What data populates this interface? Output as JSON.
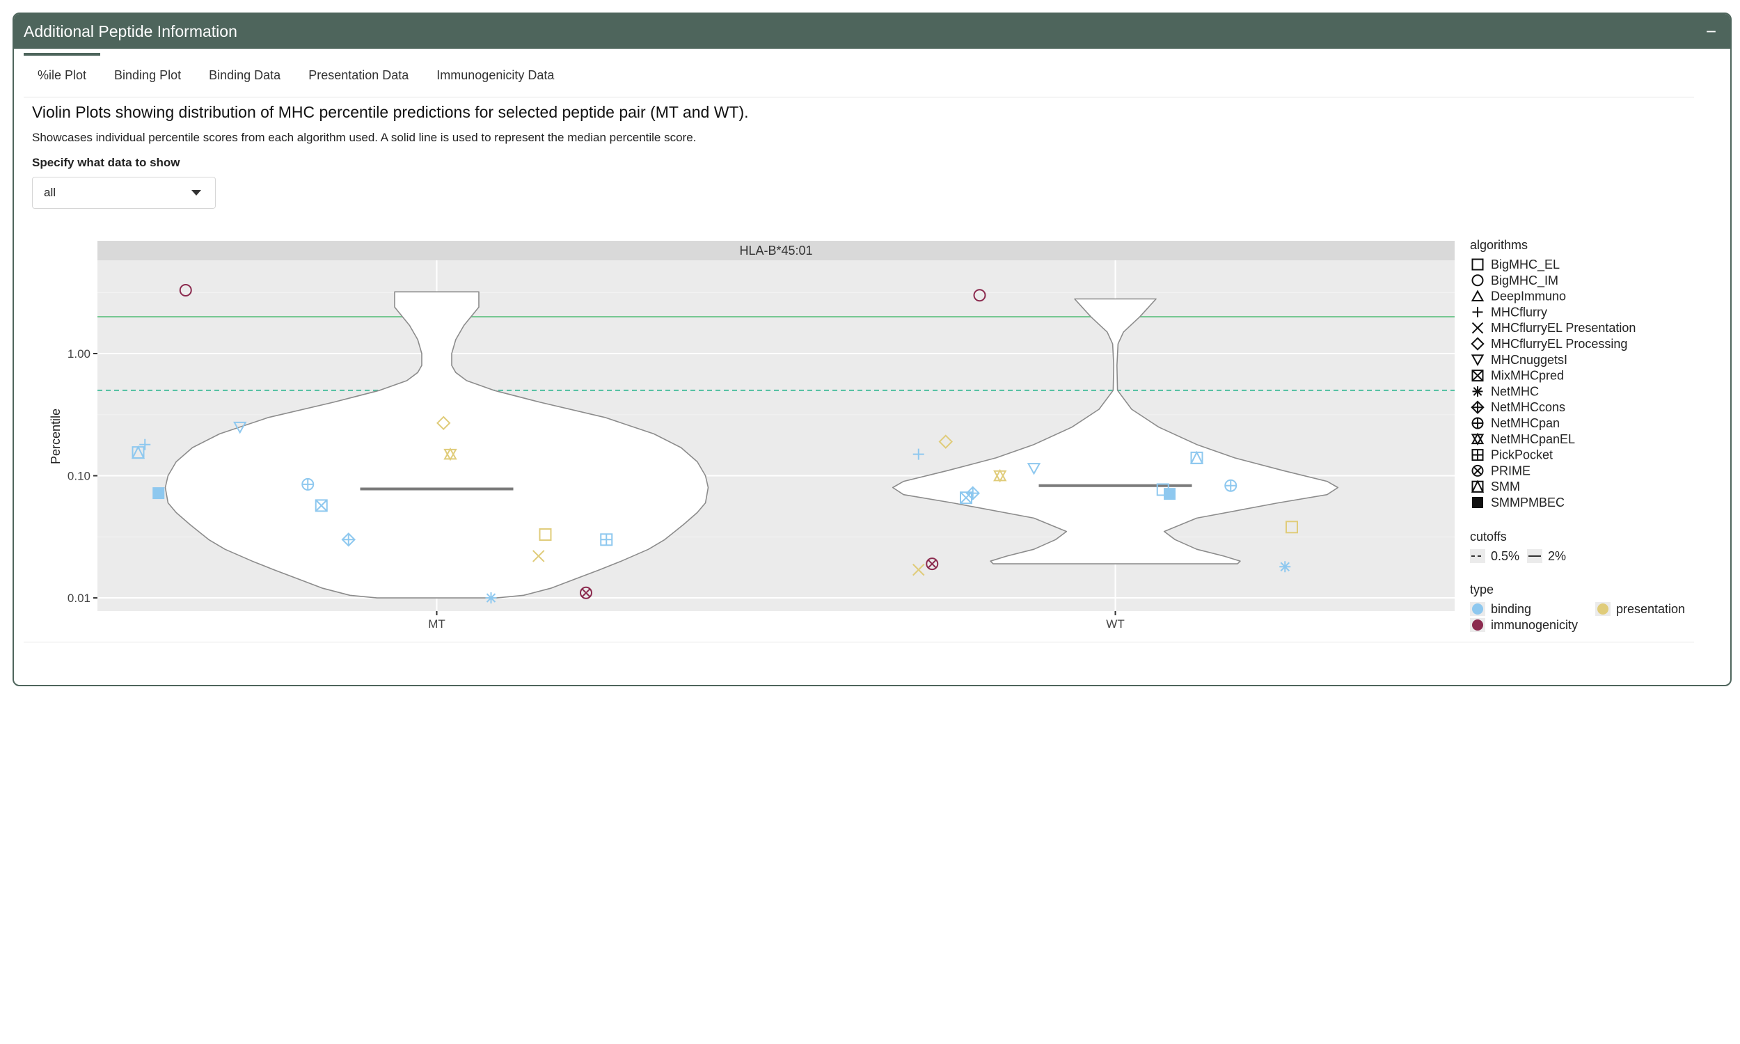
{
  "panel": {
    "title": "Additional Peptide Information",
    "collapse_label": "−"
  },
  "tabs": [
    {
      "label": "%ile Plot",
      "active": true
    },
    {
      "label": "Binding Plot",
      "active": false
    },
    {
      "label": "Binding Data",
      "active": false
    },
    {
      "label": "Presentation Data",
      "active": false
    },
    {
      "label": "Immunogenicity Data",
      "active": false
    }
  ],
  "description": {
    "title": "Violin Plots showing distribution of MHC percentile predictions for selected peptide pair (MT and WT).",
    "subtitle": "Showcases individual percentile scores from each algorithm used. A solid line is used to represent the median percentile score."
  },
  "filter": {
    "label": "Specify what data to show",
    "selected": "all"
  },
  "chart_data": {
    "type": "violin",
    "facet_title": "HLA-B*45:01",
    "ylabel": "Percentile",
    "y_scale": "log10",
    "ylim": [
      0.0078,
      5.8
    ],
    "yticks": [
      {
        "value": 0.01,
        "label": "0.01"
      },
      {
        "value": 0.1,
        "label": "0.10"
      },
      {
        "value": 1.0,
        "label": "1.00"
      }
    ],
    "categories": [
      "MT",
      "WT"
    ],
    "cutoffs": [
      {
        "label": "0.5%",
        "value": 0.5,
        "style": "dashed",
        "color": "#4dbf9e"
      },
      {
        "label": "2%",
        "value": 2.0,
        "style": "solid",
        "color": "#6cc48a"
      }
    ],
    "medians": {
      "MT": 0.078,
      "WT": 0.083
    },
    "violins": [
      {
        "category": "MT",
        "profile": [
          [
            0.01,
            0.22
          ],
          [
            0.0105,
            0.32
          ],
          [
            0.012,
            0.42
          ],
          [
            0.014,
            0.5
          ],
          [
            0.017,
            0.6
          ],
          [
            0.02,
            0.68
          ],
          [
            0.025,
            0.78
          ],
          [
            0.03,
            0.84
          ],
          [
            0.04,
            0.91
          ],
          [
            0.05,
            0.96
          ],
          [
            0.06,
            0.99
          ],
          [
            0.08,
            1.0
          ],
          [
            0.1,
            0.99
          ],
          [
            0.13,
            0.96
          ],
          [
            0.17,
            0.9
          ],
          [
            0.22,
            0.8
          ],
          [
            0.3,
            0.62
          ],
          [
            0.4,
            0.38
          ],
          [
            0.5,
            0.21
          ],
          [
            0.6,
            0.11
          ],
          [
            0.7,
            0.07
          ],
          [
            0.8,
            0.055
          ],
          [
            1.0,
            0.055
          ],
          [
            1.3,
            0.07
          ],
          [
            1.7,
            0.1
          ],
          [
            2.4,
            0.155
          ],
          [
            3.2,
            0.155
          ]
        ]
      },
      {
        "category": "WT",
        "profile": [
          [
            0.019,
            0.45
          ],
          [
            0.02,
            0.46
          ],
          [
            0.022,
            0.4
          ],
          [
            0.025,
            0.3
          ],
          [
            0.03,
            0.22
          ],
          [
            0.035,
            0.18
          ],
          [
            0.045,
            0.3
          ],
          [
            0.06,
            0.6
          ],
          [
            0.07,
            0.78
          ],
          [
            0.08,
            0.82
          ],
          [
            0.09,
            0.78
          ],
          [
            0.11,
            0.62
          ],
          [
            0.14,
            0.44
          ],
          [
            0.18,
            0.3
          ],
          [
            0.25,
            0.16
          ],
          [
            0.35,
            0.06
          ],
          [
            0.5,
            0.008
          ],
          [
            0.8,
            0.006
          ],
          [
            1.2,
            0.01
          ],
          [
            1.5,
            0.03
          ],
          [
            2.0,
            0.09
          ],
          [
            2.8,
            0.15
          ]
        ]
      }
    ],
    "algorithms": [
      "BigMHC_EL",
      "BigMHC_IM",
      "DeepImmuno",
      "MHCflurry",
      "MHCflurryEL Presentation",
      "MHCflurryEL Processing",
      "MHCnuggetsI",
      "MixMHCpred",
      "NetMHC",
      "NetMHCcons",
      "NetMHCpan",
      "NetMHCpanEL",
      "PickPocket",
      "PRIME",
      "SMM",
      "SMMPMBEC"
    ],
    "types": [
      {
        "name": "binding",
        "color": "#8ec8ef"
      },
      {
        "name": "presentation",
        "color": "#e0cc7a"
      },
      {
        "name": "immunogenicity",
        "color": "#8b2a4e"
      }
    ],
    "legend_titles": {
      "algorithms": "algorithms",
      "cutoffs": "cutoffs",
      "type": "type"
    },
    "points": [
      {
        "category": "MT",
        "algorithm": "BigMHC_IM",
        "type": "immunogenicity",
        "offset": -0.37,
        "value": 3.3
      },
      {
        "category": "MT",
        "algorithm": "MHCflurry",
        "type": "binding",
        "offset": -0.43,
        "value": 0.18
      },
      {
        "category": "MT",
        "algorithm": "SMM",
        "type": "binding",
        "offset": -0.44,
        "value": 0.155
      },
      {
        "category": "MT",
        "algorithm": "MHCnuggetsI",
        "type": "binding",
        "offset": -0.29,
        "value": 0.25
      },
      {
        "category": "MT",
        "algorithm": "SMMPMBEC",
        "type": "binding",
        "offset": -0.41,
        "value": 0.072
      },
      {
        "category": "MT",
        "algorithm": "NetMHCpan",
        "type": "binding",
        "offset": -0.19,
        "value": 0.085
      },
      {
        "category": "MT",
        "algorithm": "MixMHCpred",
        "type": "binding",
        "offset": -0.17,
        "value": 0.057
      },
      {
        "category": "MT",
        "algorithm": "NetMHCcons",
        "type": "binding",
        "offset": -0.13,
        "value": 0.03
      },
      {
        "category": "MT",
        "algorithm": "MHCflurryEL Processing",
        "type": "presentation",
        "offset": 0.01,
        "value": 0.27
      },
      {
        "category": "MT",
        "algorithm": "NetMHCpanEL",
        "type": "presentation",
        "offset": 0.02,
        "value": 0.15
      },
      {
        "category": "MT",
        "algorithm": "BigMHC_EL",
        "type": "presentation",
        "offset": 0.16,
        "value": 0.033
      },
      {
        "category": "MT",
        "algorithm": "MHCflurryEL Presentation",
        "type": "presentation",
        "offset": 0.15,
        "value": 0.022
      },
      {
        "category": "MT",
        "algorithm": "PickPocket",
        "type": "binding",
        "offset": 0.25,
        "value": 0.03
      },
      {
        "category": "MT",
        "algorithm": "NetMHC",
        "type": "binding",
        "offset": 0.08,
        "value": 0.01
      },
      {
        "category": "MT",
        "algorithm": "PRIME",
        "type": "immunogenicity",
        "offset": 0.22,
        "value": 0.011
      },
      {
        "category": "WT",
        "algorithm": "BigMHC_IM",
        "type": "immunogenicity",
        "offset": -0.2,
        "value": 3.0
      },
      {
        "category": "WT",
        "algorithm": "MHCflurryEL Processing",
        "type": "presentation",
        "offset": -0.25,
        "value": 0.19
      },
      {
        "category": "WT",
        "algorithm": "MHCflurry",
        "type": "binding",
        "offset": -0.29,
        "value": 0.15
      },
      {
        "category": "WT",
        "algorithm": "MHCnuggetsI",
        "type": "binding",
        "offset": -0.12,
        "value": 0.115
      },
      {
        "category": "WT",
        "algorithm": "NetMHCpanEL",
        "type": "presentation",
        "offset": -0.17,
        "value": 0.1
      },
      {
        "category": "WT",
        "algorithm": "NetMHCcons",
        "type": "binding",
        "offset": -0.21,
        "value": 0.072
      },
      {
        "category": "WT",
        "algorithm": "MixMHCpred",
        "type": "binding",
        "offset": -0.22,
        "value": 0.066
      },
      {
        "category": "WT",
        "algorithm": "MHCflurryEL Presentation",
        "type": "presentation",
        "offset": -0.29,
        "value": 0.017
      },
      {
        "category": "WT",
        "algorithm": "PRIME",
        "type": "immunogenicity",
        "offset": -0.27,
        "value": 0.019
      },
      {
        "category": "WT",
        "algorithm": "SMM",
        "type": "binding",
        "offset": 0.12,
        "value": 0.14
      },
      {
        "category": "WT",
        "algorithm": "NetMHCpan",
        "type": "binding",
        "offset": 0.17,
        "value": 0.083
      },
      {
        "category": "WT",
        "algorithm": "BigMHC_EL",
        "type": "binding",
        "offset": 0.07,
        "value": 0.077
      },
      {
        "category": "WT",
        "algorithm": "SMMPMBEC",
        "type": "binding",
        "offset": 0.08,
        "value": 0.071
      },
      {
        "category": "WT",
        "algorithm": "BigMHC_EL",
        "type": "presentation",
        "offset": 0.26,
        "value": 0.038
      },
      {
        "category": "WT",
        "algorithm": "NetMHC",
        "type": "binding",
        "offset": 0.25,
        "value": 0.018
      }
    ]
  }
}
